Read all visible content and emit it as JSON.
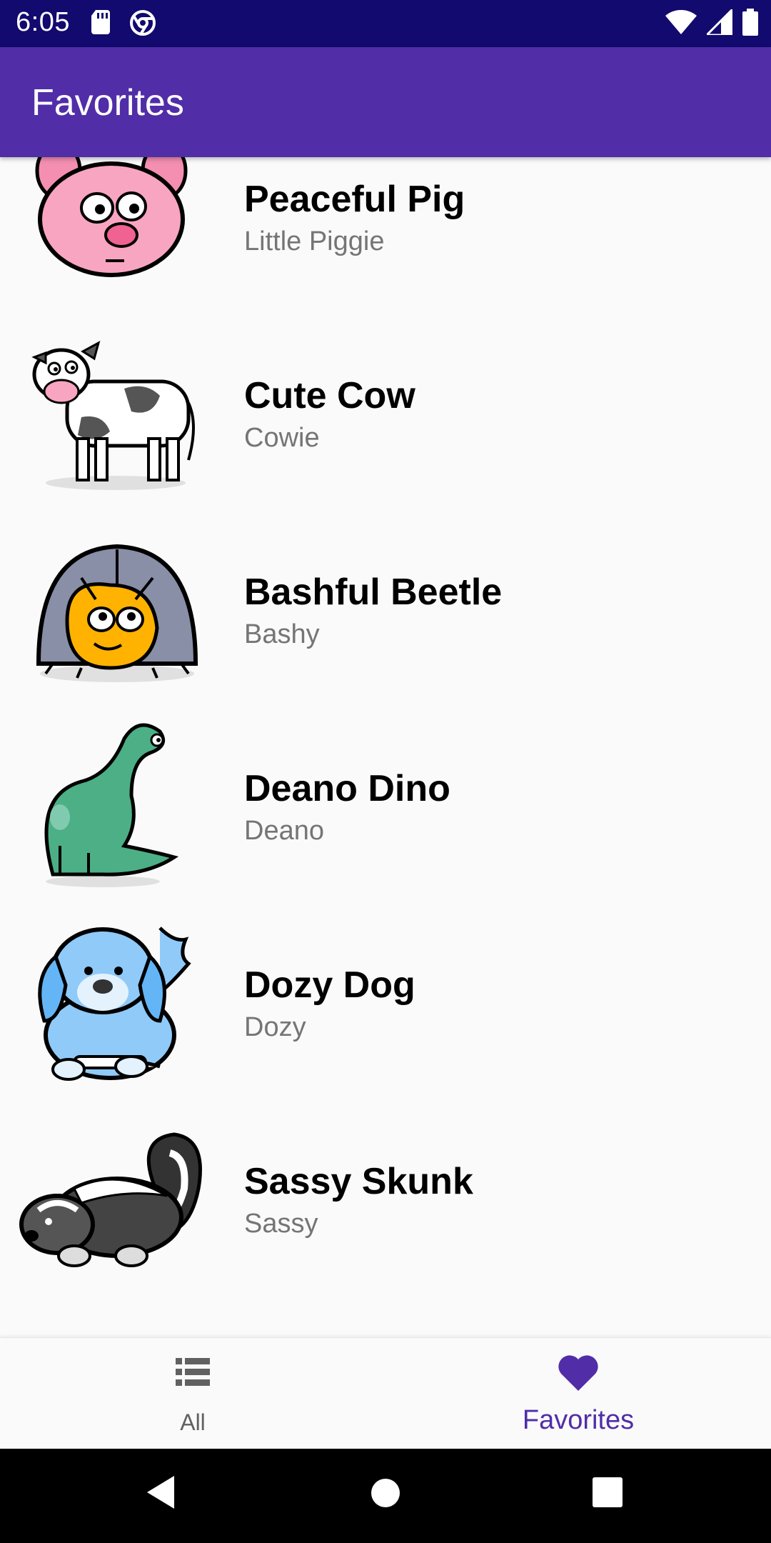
{
  "status_bar": {
    "time": "6:05",
    "left_icons": [
      "sd-card-icon",
      "chrome-icon"
    ],
    "right_icons": [
      "wifi-icon",
      "cell-signal-icon",
      "battery-icon"
    ]
  },
  "app_bar": {
    "title": "Favorites"
  },
  "animals": [
    {
      "name": "Peaceful Pig",
      "nickname": "Little Piggie",
      "icon": "pig-icon"
    },
    {
      "name": "Cute Cow",
      "nickname": "Cowie",
      "icon": "cow-icon"
    },
    {
      "name": "Bashful Beetle",
      "nickname": "Bashy",
      "icon": "beetle-icon"
    },
    {
      "name": "Deano Dino",
      "nickname": "Deano",
      "icon": "dino-icon"
    },
    {
      "name": "Dozy Dog",
      "nickname": "Dozy",
      "icon": "dog-icon"
    },
    {
      "name": "Sassy Skunk",
      "nickname": "Sassy",
      "icon": "skunk-icon"
    }
  ],
  "bottom_nav": {
    "items": [
      {
        "label": "All",
        "icon": "list-icon",
        "selected": false
      },
      {
        "label": "Favorites",
        "icon": "heart-icon",
        "selected": true
      }
    ]
  },
  "colors": {
    "status_bar": "#120a6e",
    "app_bar": "#512da8",
    "accent": "#512da8",
    "background": "#fafafa"
  }
}
